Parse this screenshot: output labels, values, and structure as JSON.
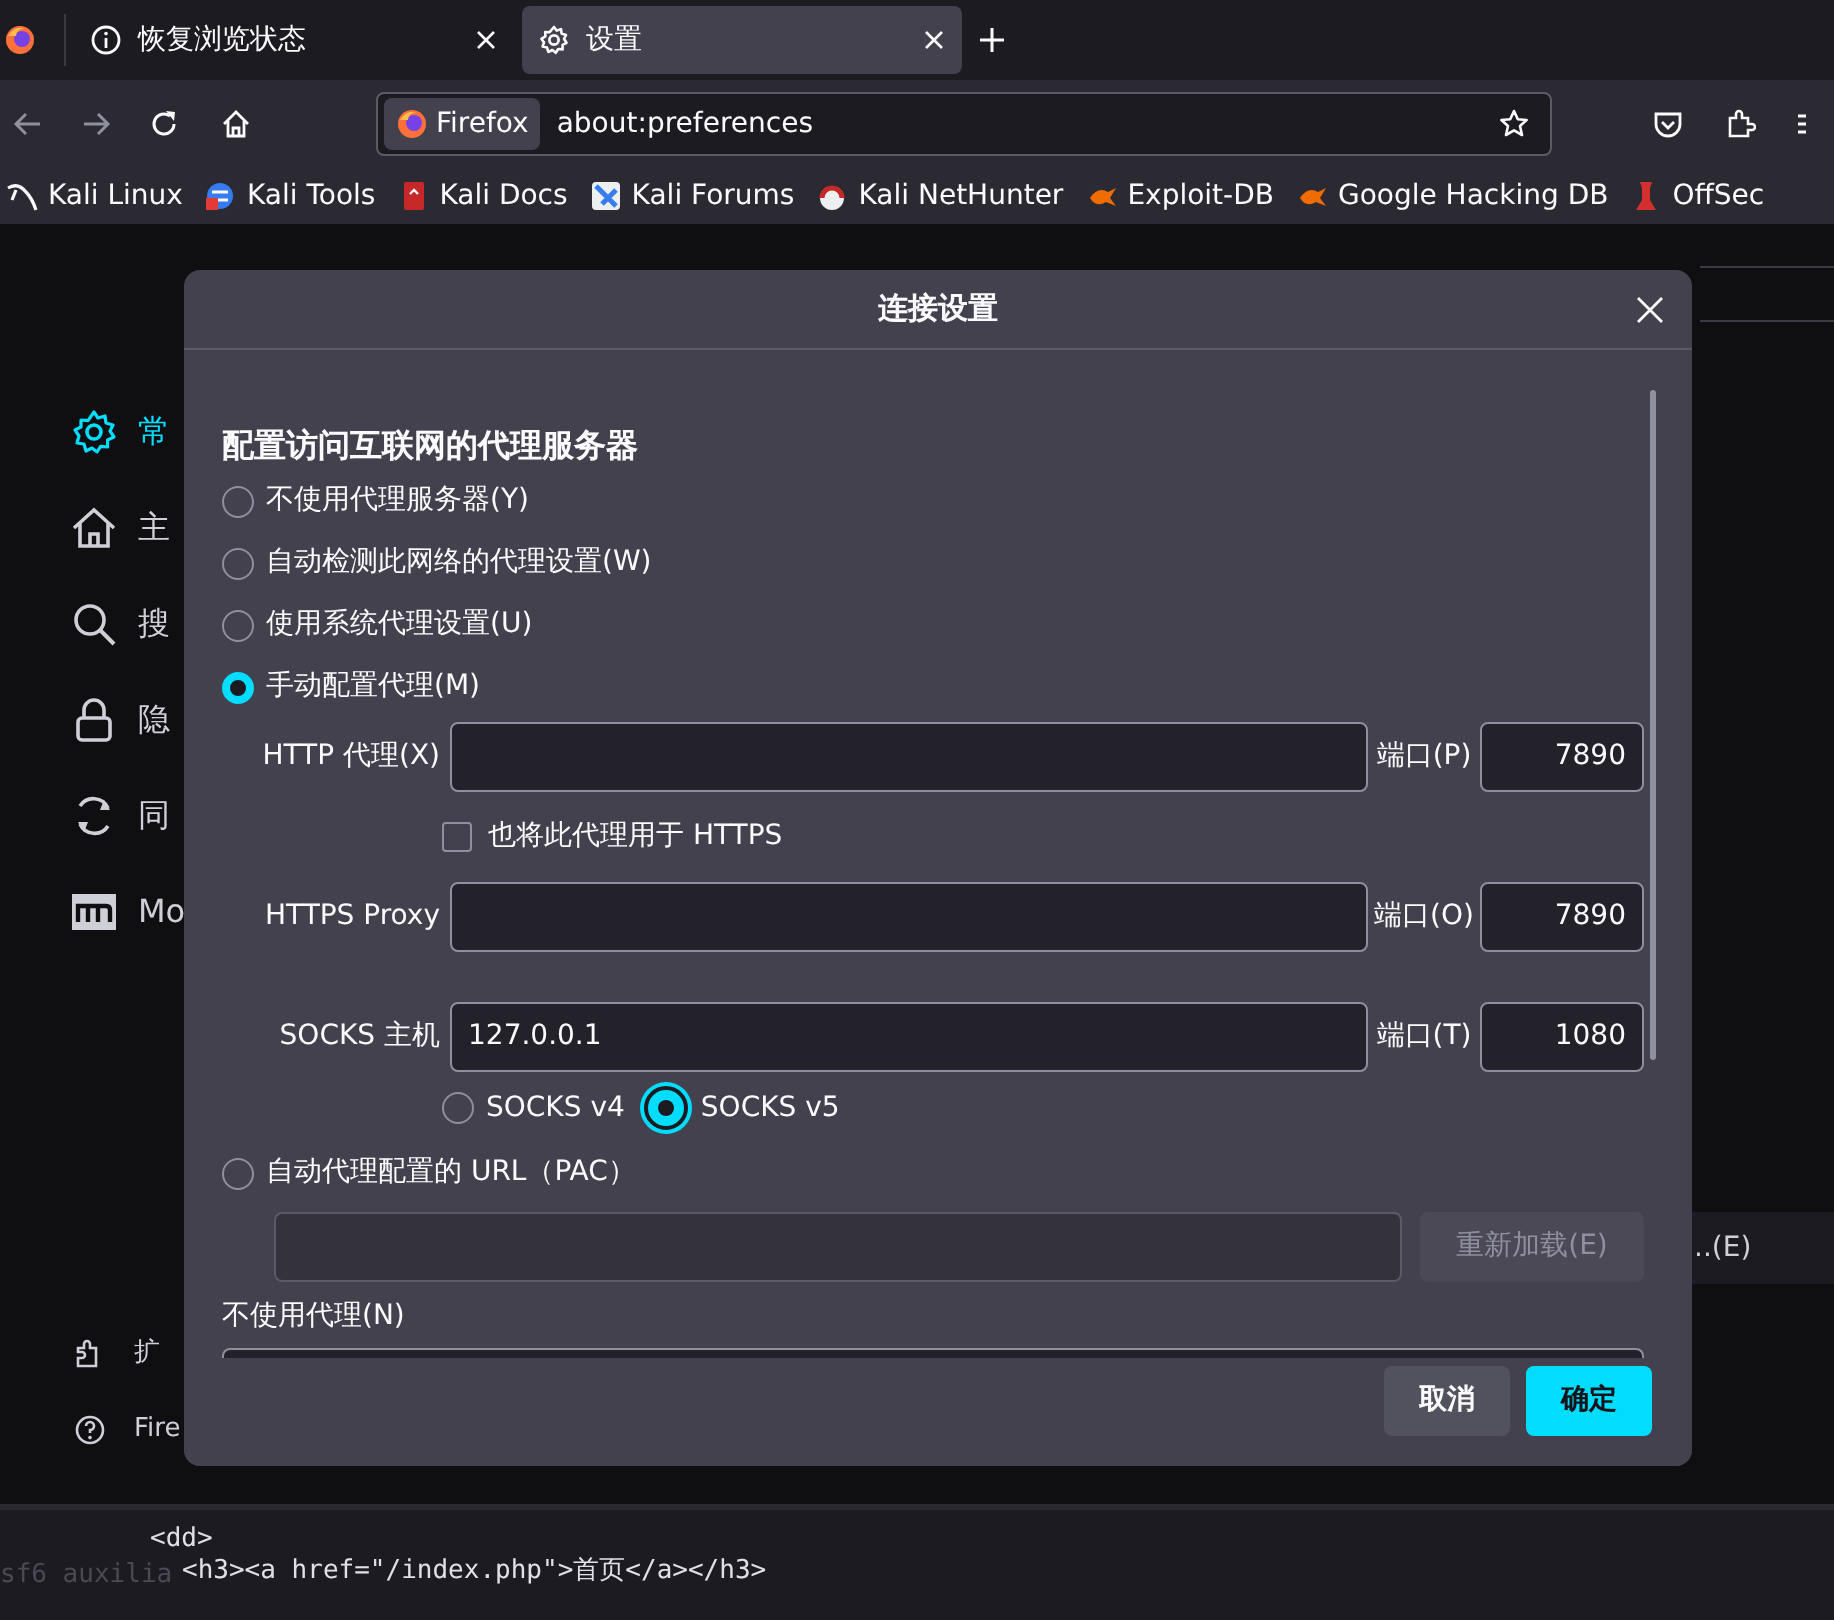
{
  "tabs": [
    {
      "label": "恢复浏览状态",
      "selected": false
    },
    {
      "label": "设置",
      "selected": true
    }
  ],
  "url_bar": {
    "identity": "Firefox",
    "value": "about:preferences"
  },
  "bookmarks": [
    {
      "label": "Kali Linux"
    },
    {
      "label": "Kali Tools"
    },
    {
      "label": "Kali Docs"
    },
    {
      "label": "Kali Forums"
    },
    {
      "label": "Kali NetHunter"
    },
    {
      "label": "Exploit-DB"
    },
    {
      "label": "Google Hacking DB"
    },
    {
      "label": "OffSec"
    }
  ],
  "sidebar": {
    "items": [
      {
        "label": "常",
        "selected": true
      },
      {
        "label": "主",
        "selected": false
      },
      {
        "label": "搜",
        "selected": false
      },
      {
        "label": "隐",
        "selected": false
      },
      {
        "label": "同",
        "selected": false
      },
      {
        "label": "Mo",
        "selected": false
      }
    ],
    "footer": [
      {
        "label": "扩"
      },
      {
        "label": "Fire"
      }
    ]
  },
  "page_side_text": "..(E)",
  "dialog": {
    "title": "连接设置",
    "heading": "配置访问互联网的代理服务器",
    "proxy_modes": [
      {
        "label": "不使用代理服务器(Y)",
        "selected": false
      },
      {
        "label": "自动检测此网络的代理设置(W)",
        "selected": false
      },
      {
        "label": "使用系统代理设置(U)",
        "selected": false
      },
      {
        "label": "手动配置代理(M)",
        "selected": true,
        "kind": "manual"
      },
      {
        "label": "自动代理配置的 URL（PAC）",
        "selected": false,
        "kind": "pac"
      }
    ],
    "manual": {
      "http": {
        "label": "HTTP 代理(X)",
        "port_label": "端口(P)",
        "port": "7890"
      },
      "also_https": {
        "label": "也将此代理用于 HTTPS",
        "checked": false
      },
      "https": {
        "label": "HTTPS Proxy",
        "port_label": "端口(O)",
        "port": "7890"
      },
      "socks": {
        "label": "SOCKS 主机",
        "value": "127.0.0.1",
        "port_label": "端口(T)",
        "port": "1080"
      },
      "socks_versions": [
        {
          "label": "SOCKS v4",
          "selected": false
        },
        {
          "label": "SOCKS v5",
          "selected": true
        }
      ]
    },
    "pac": {
      "reload_button": {
        "label": "重新加载(E)",
        "disabled": true
      }
    },
    "no_proxy": {
      "label": "不使用代理(N)"
    },
    "buttons": [
      {
        "label": "取消",
        "kind": "secondary"
      },
      {
        "label": "确定",
        "kind": "primary"
      }
    ]
  },
  "terminal": {
    "faded": "sf6 auxilia",
    "lines": [
      "<dd>",
      "<h3><a href=\"/index.php\">首页</a></h3>"
    ]
  }
}
